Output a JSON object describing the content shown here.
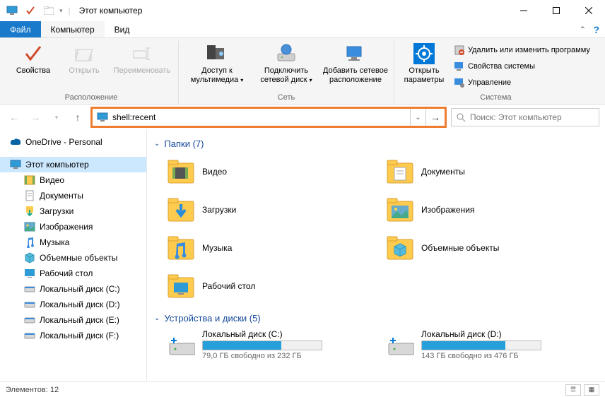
{
  "window": {
    "title": "Этот компьютер"
  },
  "menu": {
    "file": "Файл",
    "computer": "Компьютер",
    "view": "Вид"
  },
  "ribbon": {
    "group_location": "Расположение",
    "group_network": "Сеть",
    "group_system": "Система",
    "properties": "Свойства",
    "open": "Открыть",
    "rename": "Переименовать",
    "media": "Доступ к мультимедиа",
    "netdrive": "Подключить сетевой диск",
    "addnet": "Добавить сетевое расположение",
    "openparams": "Открыть параметры",
    "uninstall": "Удалить или изменить программу",
    "sysprops": "Свойства системы",
    "manage": "Управление"
  },
  "address": {
    "value": "shell:recent"
  },
  "search": {
    "placeholder": "Поиск: Этот компьютер"
  },
  "tree": {
    "onedrive": "OneDrive - Personal",
    "thispc": "Этот компьютер",
    "videos": "Видео",
    "documents": "Документы",
    "downloads": "Загрузки",
    "pictures": "Изображения",
    "music": "Музыка",
    "objects3d": "Объемные объекты",
    "desktop": "Рабочий стол",
    "diskC": "Локальный диск (C:)",
    "diskD": "Локальный диск (D:)",
    "diskE": "Локальный диск (E:)",
    "diskF": "Локальный диск (F:)"
  },
  "content": {
    "folders_header": "Папки (7)",
    "drives_header": "Устройства и диски (5)",
    "folders": {
      "videos": "Видео",
      "documents": "Документы",
      "downloads": "Загрузки",
      "pictures": "Изображения",
      "music": "Музыка",
      "objects3d": "Объемные объекты",
      "desktop": "Рабочий стол"
    },
    "drives": [
      {
        "name": "Локальный диск (C:)",
        "free": "79,0 ГБ свободно из 232 ГБ",
        "fillPct": 66
      },
      {
        "name": "Локальный диск (D:)",
        "free": "143 ГБ свободно из 476 ГБ",
        "fillPct": 70
      }
    ]
  },
  "status": {
    "items": "Элементов: 12"
  }
}
